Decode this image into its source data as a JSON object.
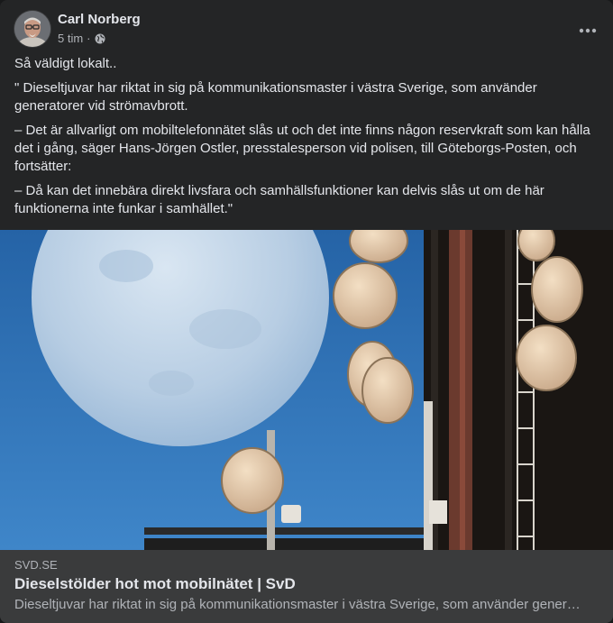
{
  "post": {
    "author": "Carl Norberg",
    "time": "5 tim",
    "separator": "·",
    "privacy_icon": "globe-icon",
    "more_icon": "more-horizontal-icon",
    "paragraphs": [
      "Så väldigt lokalt..",
      "\" Dieseltjuvar har riktat in sig på kommunikationsmaster i västra Sverige, som använder generatorer vid strömavbrott.",
      "– Det är allvarligt om mobiltelefonnätet slås ut och det inte finns någon reservkraft som kan hålla det i gång, säger Hans-Jörgen Ostler, presstalesperson vid polisen, till Göteborgs-Posten, och fortsätter:",
      "– Då kan det innebära direkt livsfara och samhällsfunktioner kan delvis slås ut om de här funktionerna inte funkar i samhället.\""
    ]
  },
  "link_preview": {
    "domain": "SVD.SE",
    "title": "Dieselstölder hot mot mobilnätet | SvD",
    "description": "Dieseltjuvar har riktat in sig på kommunikationsmaster i västra Sverige, som använder generatorer vid strömavbrott."
  },
  "colors": {
    "card_bg": "#242526",
    "link_box_bg": "#3a3b3c",
    "primary_text": "#e4e6eb",
    "secondary_text": "#b0b3b8",
    "sky": "#2f6fb0"
  }
}
